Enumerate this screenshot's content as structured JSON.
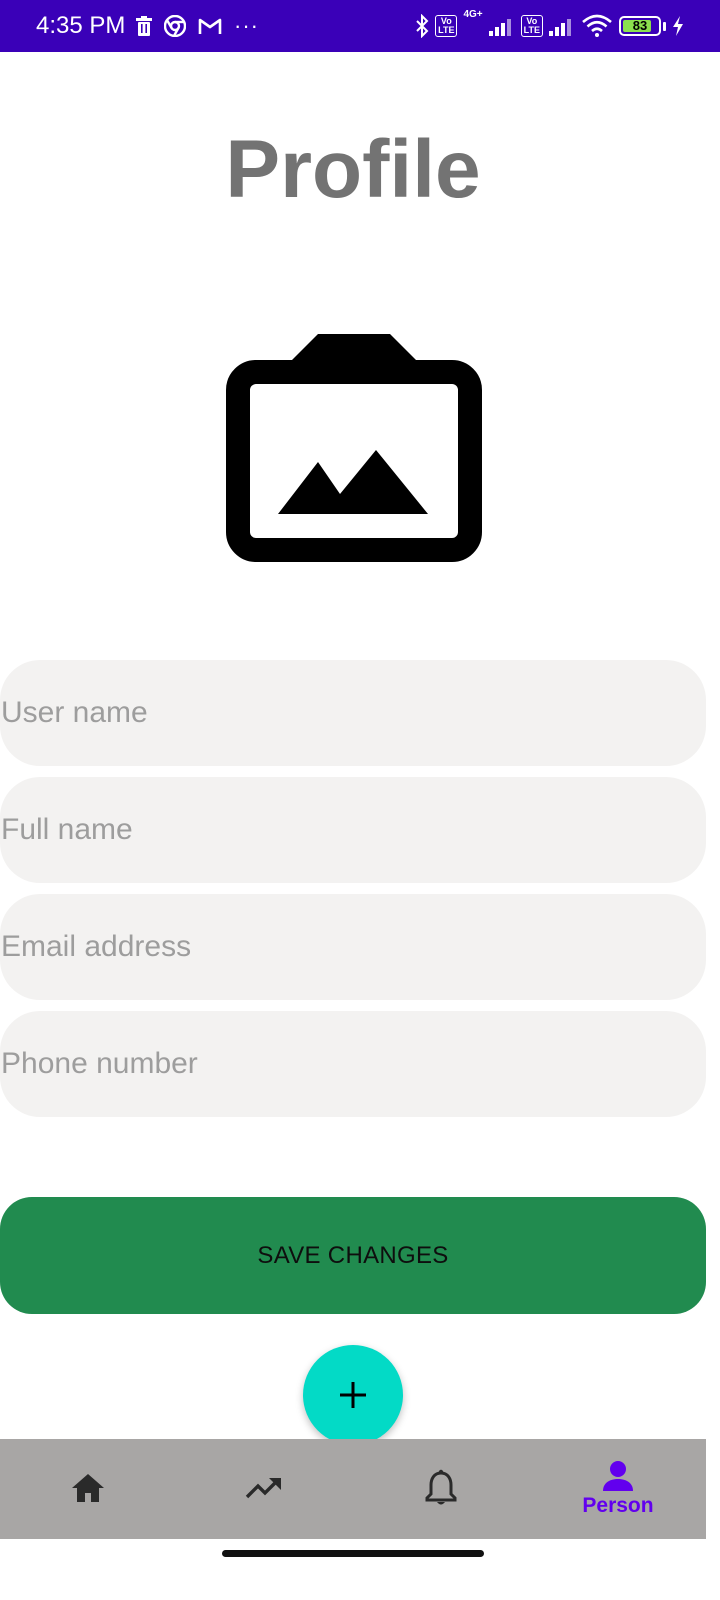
{
  "status_bar": {
    "time": "4:35 PM",
    "left_icons": [
      "trash-icon",
      "chrome-icon",
      "gmail-icon"
    ],
    "more": "···",
    "right_icons": [
      "bluetooth-icon",
      "volte-icon",
      "signal-icon",
      "volte-icon",
      "signal-icon",
      "wifi-icon",
      "battery-icon",
      "charging-icon"
    ],
    "lte_label_top": "Vo",
    "lte_label_bottom": "LTE",
    "network_type": "4G+",
    "battery_level": "83",
    "battery_fraction": 0.83
  },
  "page": {
    "title": "Profile",
    "photo_icon": "add-photo-icon"
  },
  "form": {
    "username_placeholder": "User name",
    "fullname_placeholder": "Full name",
    "email_placeholder": "Email address",
    "phone_placeholder": "Phone number",
    "save_label": "SAVE CHANGES"
  },
  "fab": {
    "icon": "plus-icon"
  },
  "bottom_nav": {
    "items": [
      {
        "icon": "home-icon",
        "label": ""
      },
      {
        "icon": "trending-up-icon",
        "label": ""
      },
      {
        "icon": "bell-icon",
        "label": ""
      },
      {
        "icon": "person-icon",
        "label": "Person",
        "selected": true
      }
    ]
  },
  "colors": {
    "status_bar": "#3a00b8",
    "title": "#737373",
    "field_bg": "#f3f2f1",
    "save_button": "#218b4f",
    "fab": "#03dac6",
    "nav_bg": "#a8a6a5",
    "nav_selected": "#6200ee"
  }
}
